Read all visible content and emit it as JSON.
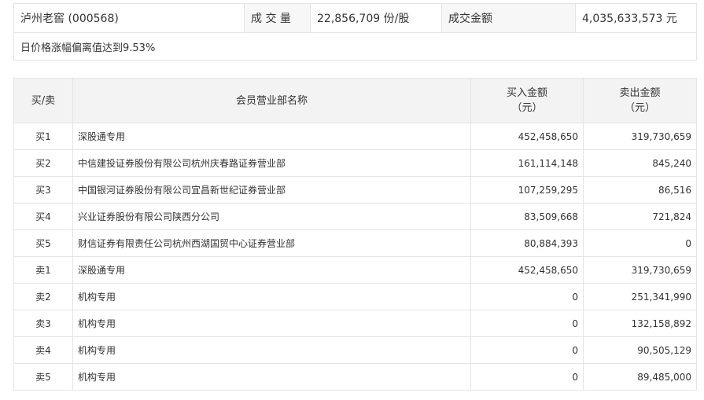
{
  "summary": {
    "stock": "泸州老窖 (000568)",
    "volume_label": "成 交 量",
    "volume_value": "22,856,709 份/股",
    "amount_label": "成交金额",
    "amount_value": "4,035,633,573 元",
    "reason": "日价格涨幅偏离值达到9.53%"
  },
  "table": {
    "headers": {
      "side": "买/卖",
      "name": "会员营业部名称",
      "buy_line1": "买入金额",
      "buy_line2": "（元）",
      "sell_line1": "卖出金额",
      "sell_line2": "（元）"
    },
    "rows": [
      {
        "side": "买1",
        "name": "深股通专用",
        "buy": "452,458,650",
        "sell": "319,730,659"
      },
      {
        "side": "买2",
        "name": "中信建投证券股份有限公司杭州庆春路证券营业部",
        "buy": "161,114,148",
        "sell": "845,240"
      },
      {
        "side": "买3",
        "name": "中国银河证券股份有限公司宜昌新世纪证券营业部",
        "buy": "107,259,295",
        "sell": "86,516"
      },
      {
        "side": "买4",
        "name": "兴业证券股份有限公司陕西分公司",
        "buy": "83,509,668",
        "sell": "721,824"
      },
      {
        "side": "买5",
        "name": "财信证券有限责任公司杭州西湖国贸中心证券营业部",
        "buy": "80,884,393",
        "sell": "0"
      },
      {
        "side": "卖1",
        "name": "深股通专用",
        "buy": "452,458,650",
        "sell": "319,730,659"
      },
      {
        "side": "卖2",
        "name": "机构专用",
        "buy": "0",
        "sell": "251,341,990"
      },
      {
        "side": "卖3",
        "name": "机构专用",
        "buy": "0",
        "sell": "132,158,892"
      },
      {
        "side": "卖4",
        "name": "机构专用",
        "buy": "0",
        "sell": "90,505,129"
      },
      {
        "side": "卖5",
        "name": "机构专用",
        "buy": "0",
        "sell": "89,485,000"
      }
    ]
  }
}
